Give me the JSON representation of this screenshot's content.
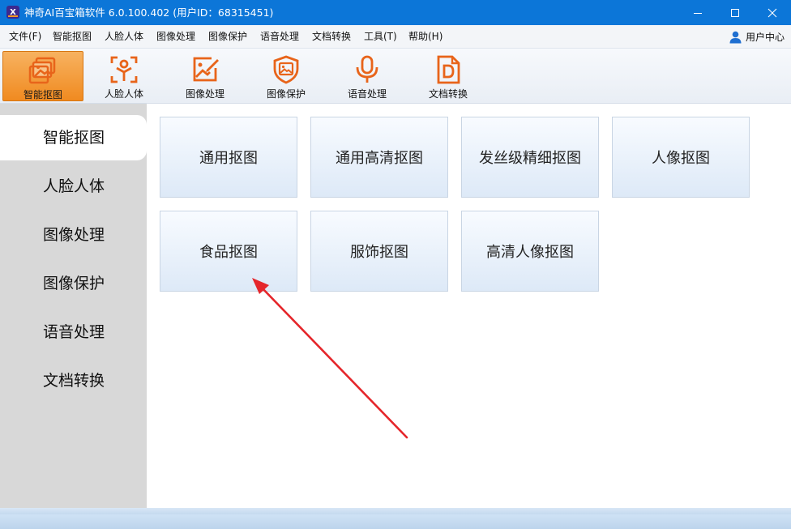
{
  "window": {
    "title": "神奇AI百宝箱软件 6.0.100.402 (用户ID：68315451)",
    "app_logo_text": "X",
    "title_bar_color": "#0c76d8"
  },
  "menu": {
    "items": [
      "文件(F)",
      "智能抠图",
      "人脸人体",
      "图像处理",
      "图像保护",
      "语音处理",
      "文档转换",
      "工具(T)",
      "帮助(H)"
    ],
    "user_center": "用户中心"
  },
  "toolbar": {
    "accent_color": "#e8641a",
    "items": [
      {
        "label": "智能抠图",
        "icon": "image-stack-icon",
        "active": true
      },
      {
        "label": "人脸人体",
        "icon": "face-body-icon",
        "active": false
      },
      {
        "label": "图像处理",
        "icon": "image-edit-icon",
        "active": false
      },
      {
        "label": "图像保护",
        "icon": "image-shield-icon",
        "active": false
      },
      {
        "label": "语音处理",
        "icon": "microphone-icon",
        "active": false
      },
      {
        "label": "文档转换",
        "icon": "document-convert-icon",
        "active": false
      }
    ]
  },
  "sidebar": {
    "items": [
      {
        "label": "智能抠图",
        "active": true
      },
      {
        "label": "人脸人体",
        "active": false
      },
      {
        "label": "图像处理",
        "active": false
      },
      {
        "label": "图像保护",
        "active": false
      },
      {
        "label": "语音处理",
        "active": false
      },
      {
        "label": "文档转换",
        "active": false
      }
    ]
  },
  "cards": [
    {
      "label": "通用抠图"
    },
    {
      "label": "通用高清抠图"
    },
    {
      "label": "发丝级精细抠图"
    },
    {
      "label": "人像抠图"
    },
    {
      "label": "食品抠图"
    },
    {
      "label": "服饰抠图"
    },
    {
      "label": "高清人像抠图"
    }
  ],
  "annotation": {
    "arrow_color": "#e5262b",
    "points_to": "食品抠图"
  }
}
